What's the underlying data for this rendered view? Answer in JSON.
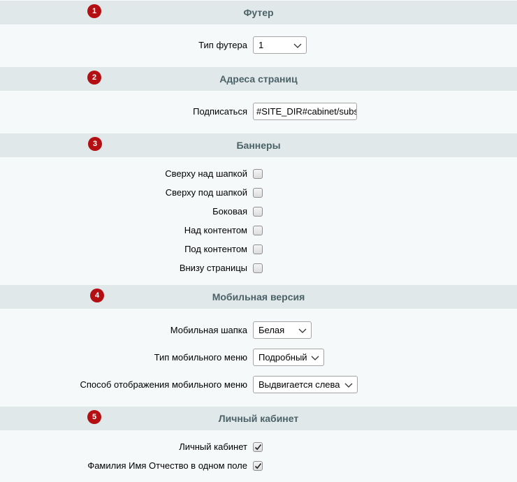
{
  "sections": [
    {
      "num": "1",
      "title": "Футер"
    },
    {
      "num": "2",
      "title": "Адреса страниц"
    },
    {
      "num": "3",
      "title": "Баннеры"
    },
    {
      "num": "4",
      "title": "Мобильная версия"
    },
    {
      "num": "5",
      "title": "Личный кабинет"
    }
  ],
  "footer": {
    "type_label": "Тип футера",
    "type_value": "1"
  },
  "pages": {
    "subscribe_label": "Подписаться",
    "subscribe_value": "#SITE_DIR#cabinet/subscribe/"
  },
  "banners": [
    {
      "label": "Сверху над шапкой",
      "checked": false
    },
    {
      "label": "Сверху под шапкой",
      "checked": false
    },
    {
      "label": "Боковая",
      "checked": false
    },
    {
      "label": "Над контентом",
      "checked": false
    },
    {
      "label": "Под контентом",
      "checked": false
    },
    {
      "label": "Внизу страницы",
      "checked": false
    }
  ],
  "mobile": {
    "header_label": "Мобильная шапка",
    "header_value": "Белая",
    "menu_type_label": "Тип мобильного меню",
    "menu_type_value": "Подробный",
    "menu_display_label": "Способ отображения мобильного меню",
    "menu_display_value": "Выдвигается слева"
  },
  "cabinet": [
    {
      "label": "Личный кабинет",
      "checked": true
    },
    {
      "label": "Фамилия Имя Отчество в одном поле",
      "checked": true
    }
  ],
  "colors": {
    "badge": "#b40f12",
    "header_bg": "#e0e8ea",
    "header_text": "#4b6267",
    "page_bg": "#f5f9f9"
  }
}
